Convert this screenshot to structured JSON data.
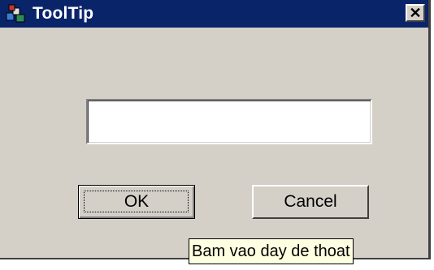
{
  "window": {
    "title": "ToolTip",
    "icon": "app-blocks-icon",
    "close_label": "✕"
  },
  "dialog": {
    "text_value": "",
    "ok_label": "OK",
    "cancel_label": "Cancel"
  },
  "tooltip": {
    "text": "Bam vao day de thoat"
  },
  "colors": {
    "titlebar": "#0a246a",
    "face": "#d4d0c8",
    "tooltip_bg": "#ffffe1"
  }
}
